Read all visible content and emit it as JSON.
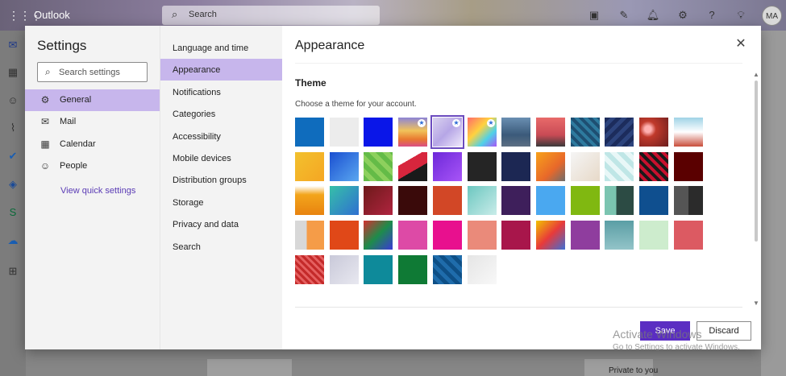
{
  "app": {
    "title": "Outlook",
    "search_placeholder": "Search",
    "avatar_initials": "MA"
  },
  "topbar_icons": [
    "meet-now-icon",
    "my-day-icon",
    "bell-icon",
    "gear-icon",
    "help-icon",
    "lightbulb-icon"
  ],
  "rail_icons": [
    "mail-icon",
    "calendar-icon",
    "people-icon",
    "attach-icon",
    "todo-icon",
    "yammer-icon",
    "sway-icon",
    "onedrive-icon",
    "apps-icon"
  ],
  "settings": {
    "title": "Settings",
    "search_placeholder": "Search settings",
    "categories": [
      {
        "label": "General",
        "icon": "gear-icon",
        "selected": true
      },
      {
        "label": "Mail",
        "icon": "mail-icon",
        "selected": false
      },
      {
        "label": "Calendar",
        "icon": "calendar-icon",
        "selected": false
      },
      {
        "label": "People",
        "icon": "people-icon",
        "selected": false
      }
    ],
    "quick_link": "View quick settings",
    "subnav": [
      {
        "label": "Language and time",
        "selected": false
      },
      {
        "label": "Appearance",
        "selected": true
      },
      {
        "label": "Notifications",
        "selected": false
      },
      {
        "label": "Categories",
        "selected": false
      },
      {
        "label": "Accessibility",
        "selected": false
      },
      {
        "label": "Mobile devices",
        "selected": false
      },
      {
        "label": "Distribution groups",
        "selected": false
      },
      {
        "label": "Storage",
        "selected": false
      },
      {
        "label": "Privacy and data",
        "selected": false
      },
      {
        "label": "Search",
        "selected": false
      }
    ]
  },
  "appearance": {
    "title": "Appearance",
    "theme_heading": "Theme",
    "theme_desc": "Choose a theme for your account.",
    "selected_theme_index": 4,
    "themes": [
      {
        "bg": "#0f6cbd"
      },
      {
        "bg": "#ececec"
      },
      {
        "bg": "#0a16e8"
      },
      {
        "bg": "linear-gradient(180deg,#8d84d6 0%,#f1c35a 45%,#e9792f 75%,#d94f86 100%)",
        "star": true
      },
      {
        "bg": "linear-gradient(135deg,#d9d2ef 0%,#b6a6e6 50%,#efe9fb 100%)",
        "star": true
      },
      {
        "bg": "linear-gradient(135deg,#ff6a6a 0%,#ffd23f 40%,#4fd1e8 70%,#a855f7 100%)",
        "star": true
      },
      {
        "bg": "linear-gradient(180deg,#6a8fb2 0%,#3b5a7a 60%,#5d6f83 100%)"
      },
      {
        "bg": "linear-gradient(180deg,#e86a6a 0%,#c94b55 60%,#3a3a3a 100%)"
      },
      {
        "bg": "repeating-linear-gradient(45deg,#1e4f72 0 4px,#2e7a9e 4px 8px)"
      },
      {
        "bg": "repeating-linear-gradient(135deg,#1c2c5c 0 5px,#2d447d 5px 10px)"
      },
      {
        "bg": "radial-gradient(circle at 30% 40%,#ffb0b0 0 12%,#c0392b 30%,#6b1e1e 100%)"
      },
      {
        "bg": "linear-gradient(180deg,#9fd3e6 0%,#ffffff 50%,#c84d3b 100%)"
      },
      {
        "bg": "linear-gradient(135deg,#f2c12e 0%,#f5a623 100%)"
      },
      {
        "bg": "linear-gradient(135deg,#1a4fd1 0%,#5aa7f0 100%)"
      },
      {
        "bg": "repeating-linear-gradient(45deg,#64bb47 0 6px,#8dd05d 6px 12px)"
      },
      {
        "bg": "linear-gradient(150deg,#ffffff 0 30%,#d7263d 30% 60%,#1a1a1a 60%)"
      },
      {
        "bg": "linear-gradient(135deg,#6d28d9 0%,#a855f7 100%)"
      },
      {
        "bg": "#252525"
      },
      {
        "bg": "#1c2753"
      },
      {
        "bg": "linear-gradient(135deg,#f7a11a 0%,#e8682a 60%,#6d6d6d 100%)"
      },
      {
        "bg": "linear-gradient(135deg,#f5f5f5 0%,#e7d9c8 100%)"
      },
      {
        "bg": "repeating-linear-gradient(45deg,#bfe6e6 0 6px,#e8f7f7 6px 12px)"
      },
      {
        "bg": "repeating-linear-gradient(45deg,#1a1a1a 0 4px,#c8102e 4px 8px)"
      },
      {
        "bg": "#5a0000"
      },
      {
        "bg": "linear-gradient(180deg,#ffffff 0%,#f3a51c 30%,#e8830f 100%)"
      },
      {
        "bg": "linear-gradient(135deg,#36c0a8 0%,#2f6fd1 100%)"
      },
      {
        "bg": "linear-gradient(135deg,#6d1a1a 0%,#b0243f 100%)"
      },
      {
        "bg": "#3a0a0a"
      },
      {
        "bg": "#d24726"
      },
      {
        "bg": "linear-gradient(135deg,#6cc7c0 0%,#c9ece9 100%)"
      },
      {
        "bg": "#3e1f5b"
      },
      {
        "bg": "#4aa8f0"
      },
      {
        "bg": "#80b811"
      },
      {
        "bg": "linear-gradient(90deg,#7bc4b0 0 40%,#2c4b44 40%)"
      },
      {
        "bg": "#0f4f8f"
      },
      {
        "bg": "linear-gradient(90deg,#555 0 50%,#2b2b2b 50%)"
      },
      {
        "bg": "linear-gradient(90deg,#d8d8d8 0 40%,#f59c48 40%)"
      },
      {
        "bg": "#e04818"
      },
      {
        "bg": "linear-gradient(135deg,#d32f2f 0%,#1e8c4a 50%,#3a3ad6 100%)"
      },
      {
        "bg": "#dd4aa6"
      },
      {
        "bg": "#e8108e"
      },
      {
        "bg": "#ea8a7a"
      },
      {
        "bg": "#a8164b"
      },
      {
        "bg": "linear-gradient(135deg,#f2c200 0%,#e83a3a 50%,#3d6fd6 100%)"
      },
      {
        "bg": "#8f3d9e"
      },
      {
        "bg": "linear-gradient(180deg,#5a9ea5 0%,#93c4c8 100%)"
      },
      {
        "bg": "#cdeccd"
      },
      {
        "bg": "#dc5a62"
      },
      {
        "bg": "repeating-linear-gradient(45deg,#c42a2a 0 3px,#e56060 3px 6px)"
      },
      {
        "bg": "linear-gradient(135deg,#c9c9d9 0%,#e8e8f0 100%)"
      },
      {
        "bg": "#0e8a9a"
      },
      {
        "bg": "#0f7a35"
      },
      {
        "bg": "repeating-linear-gradient(45deg,#0e4f86 0 5px,#1f6cab 5px 10px)"
      },
      {
        "bg": "linear-gradient(135deg,#e5e5e5 0%,#f8f8f8 100%)"
      }
    ],
    "save_label": "Save",
    "discard_label": "Discard"
  },
  "watermark": {
    "line1": "Activate Windows",
    "line2": "Go to Settings to activate Windows."
  },
  "background_text": {
    "privacy": "Private to you"
  }
}
